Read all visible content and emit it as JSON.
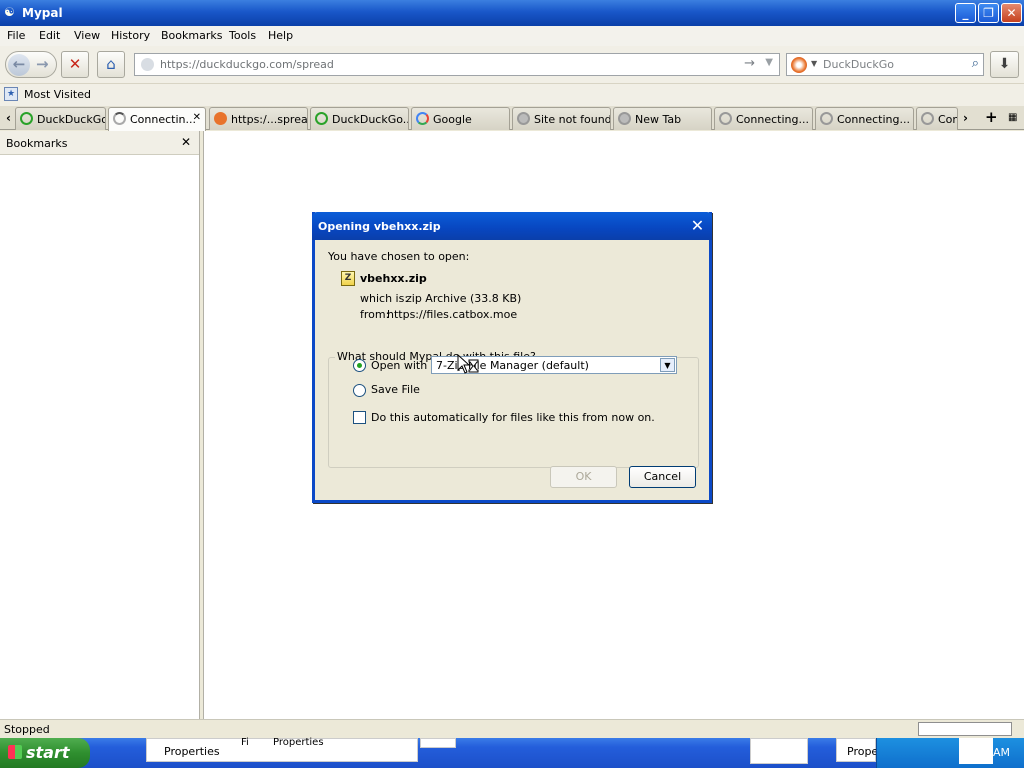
{
  "window": {
    "title": "Mypal"
  },
  "menu": [
    "File",
    "Edit",
    "View",
    "History",
    "Bookmarks",
    "Tools",
    "Help"
  ],
  "nav": {
    "url": "https://duckduckgo.com/spread",
    "search_placeholder": "DuckDuckGo"
  },
  "bookmarks_toolbar": {
    "label": "Most Visited"
  },
  "tabs": [
    {
      "label": "DuckDuckGo...",
      "icon": "duckduckgo-icon"
    },
    {
      "label": "Connectin...",
      "icon": "loading-icon",
      "selected": true
    },
    {
      "label": "https:/...spread",
      "icon": "duckduckgo-icon"
    },
    {
      "label": "DuckDuckGo...",
      "icon": "loading-icon"
    },
    {
      "label": "Google",
      "icon": "google-icon"
    },
    {
      "label": "Site not found...",
      "icon": "globe-icon"
    },
    {
      "label": "New Tab",
      "icon": "globe-icon"
    },
    {
      "label": "Connecting...",
      "icon": "loading-icon"
    },
    {
      "label": "Connecting...",
      "icon": "loading-icon"
    },
    {
      "label": "Con",
      "icon": "loading-icon"
    }
  ],
  "sidebar": {
    "title": "Bookmarks"
  },
  "status": {
    "text": "Stopped"
  },
  "taskbar": {
    "start_label": "start",
    "items": [
      "Properties",
      "Fi",
      "Properties",
      "Prope"
    ],
    "clock": "AM"
  },
  "dialog": {
    "title": "Opening vbehxx.zip",
    "intro": "You have chosen to open:",
    "filename": "vbehxx.zip",
    "which_is_label": "which is:",
    "which_is_value": "zip Archive (33.8 KB)",
    "from_label": "from:",
    "from_value": "https://files.catbox.moe",
    "question": "What should Mypal do with this file?",
    "open_with_label": "Open with",
    "open_with_value": "7-Zip File Manager (default)",
    "save_file_label": "Save File",
    "auto_label": "Do this automatically for files like this from now on.",
    "ok_label": "OK",
    "cancel_label": "Cancel",
    "selected_option": "open_with"
  }
}
